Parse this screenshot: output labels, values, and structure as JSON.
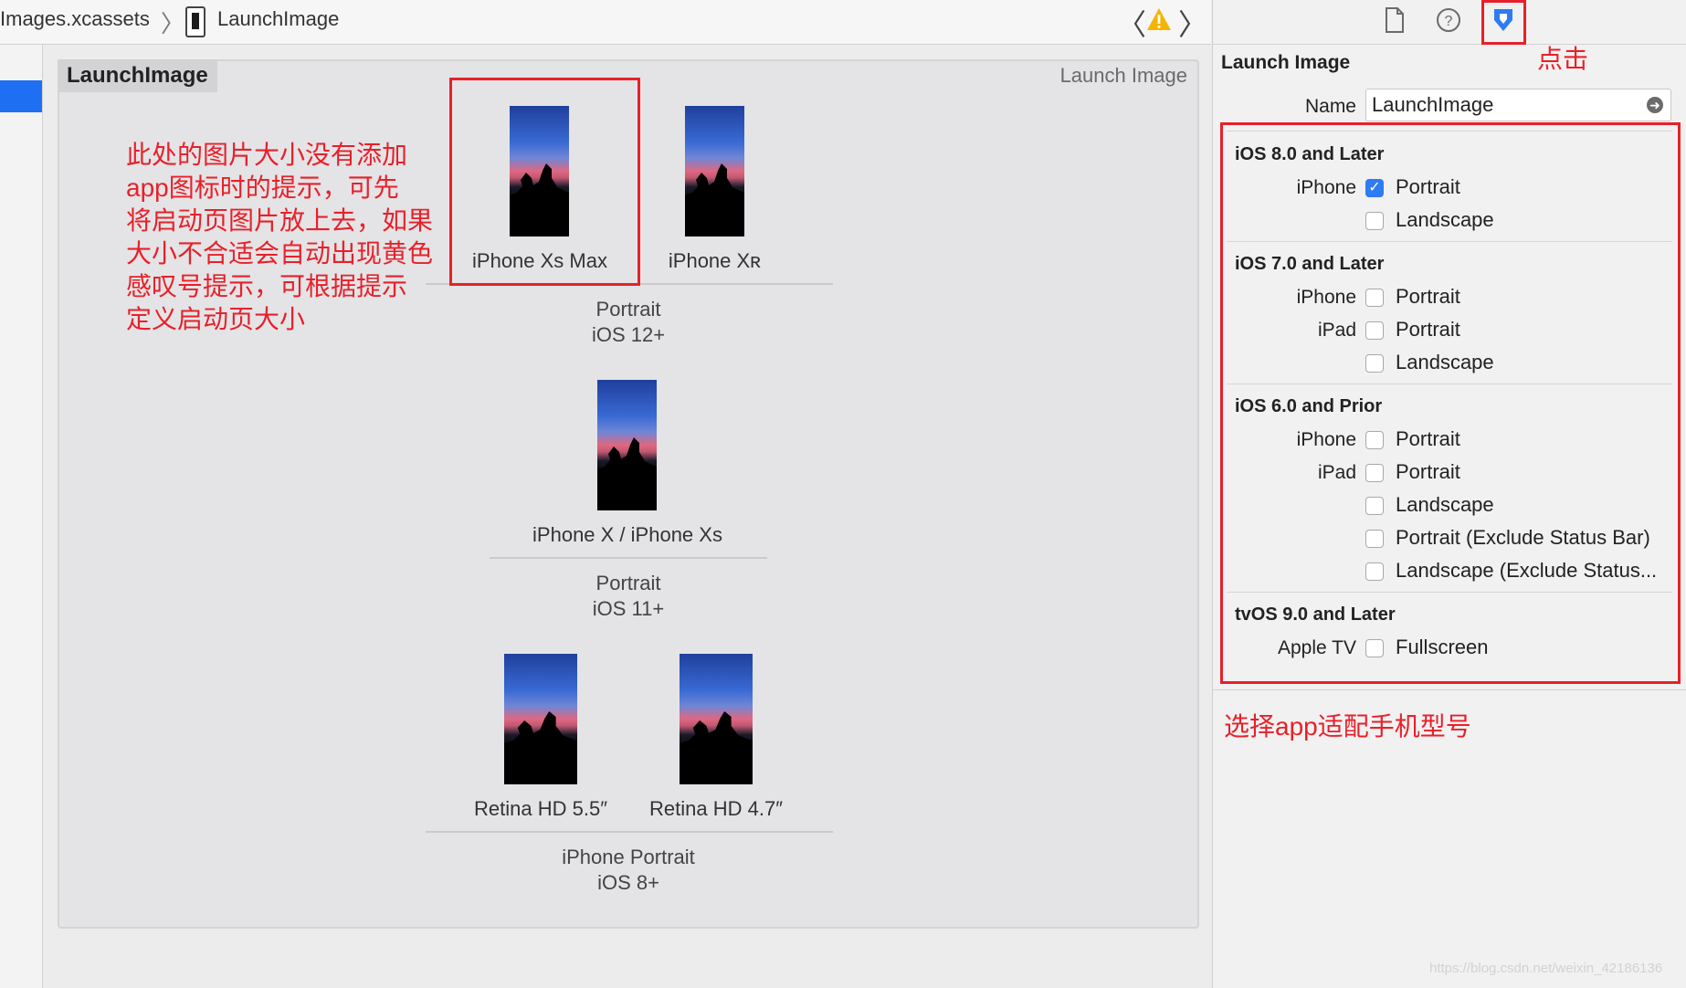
{
  "jumpbar": {
    "crumb1": "Images.xcassets",
    "crumb2": "LaunchImage",
    "separator": "〉",
    "back": "〈",
    "forward": "〉"
  },
  "editor": {
    "set_name": "LaunchImage",
    "set_kind": "Launch Image",
    "slots": {
      "xs_max": "iPhone Xs Max",
      "xr": "iPhone Xʀ",
      "x_xs": "iPhone X / iPhone Xs",
      "hd55": "Retina HD 5.5″",
      "hd47": "Retina HD 4.7″"
    },
    "groups": {
      "g1_line1": "Portrait",
      "g1_line2": "iOS 12+",
      "g2_line1": "Portrait",
      "g2_line2": "iOS 11+",
      "g3_line1": "iPhone Portrait",
      "g3_line2": "iOS 8+"
    }
  },
  "annotations": {
    "left_note": [
      "此处的图片大小没有添加",
      "app图标时的提示，可先",
      "将启动页图片放上去，如果",
      "大小不合适会自动出现黄色",
      "感叹号提示，可根据提示",
      "定义启动页大小"
    ],
    "click_note": "点击",
    "select_note": "选择app适配手机型号",
    "color": "#e8202a"
  },
  "inspector": {
    "title": "Launch Image",
    "name_label": "Name",
    "name_value": "LaunchImage",
    "tabs": [
      "file-inspector-icon",
      "help-icon",
      "attributes-inspector-icon"
    ],
    "sections": {
      "ios8": {
        "title": "iOS 8.0 and Later",
        "iphone": "iPhone",
        "portrait": "Portrait",
        "landscape": "Landscape",
        "portrait_checked": true
      },
      "ios7": {
        "title": "iOS 7.0 and Later",
        "iphone": "iPhone",
        "iphone_portrait": "Portrait",
        "ipad": "iPad",
        "ipad_portrait": "Portrait",
        "ipad_landscape": "Landscape"
      },
      "ios6": {
        "title": "iOS 6.0 and Prior",
        "iphone": "iPhone",
        "iphone_portrait": "Portrait",
        "ipad": "iPad",
        "ipad_portrait": "Portrait",
        "ipad_landscape": "Landscape",
        "ipad_portrait_nsb": "Portrait (Exclude Status Bar)",
        "ipad_landscape_nsb": "Landscape (Exclude Status..."
      },
      "tvos": {
        "title": "tvOS 9.0 and Later",
        "appletv": "Apple TV",
        "fullscreen": "Fullscreen"
      }
    }
  },
  "colors": {
    "accent": "#2f7bf3",
    "warning": "#f5b400",
    "selection": "#1e6ff1"
  },
  "watermark": "https://blog.csdn.net/weixin_42186136"
}
